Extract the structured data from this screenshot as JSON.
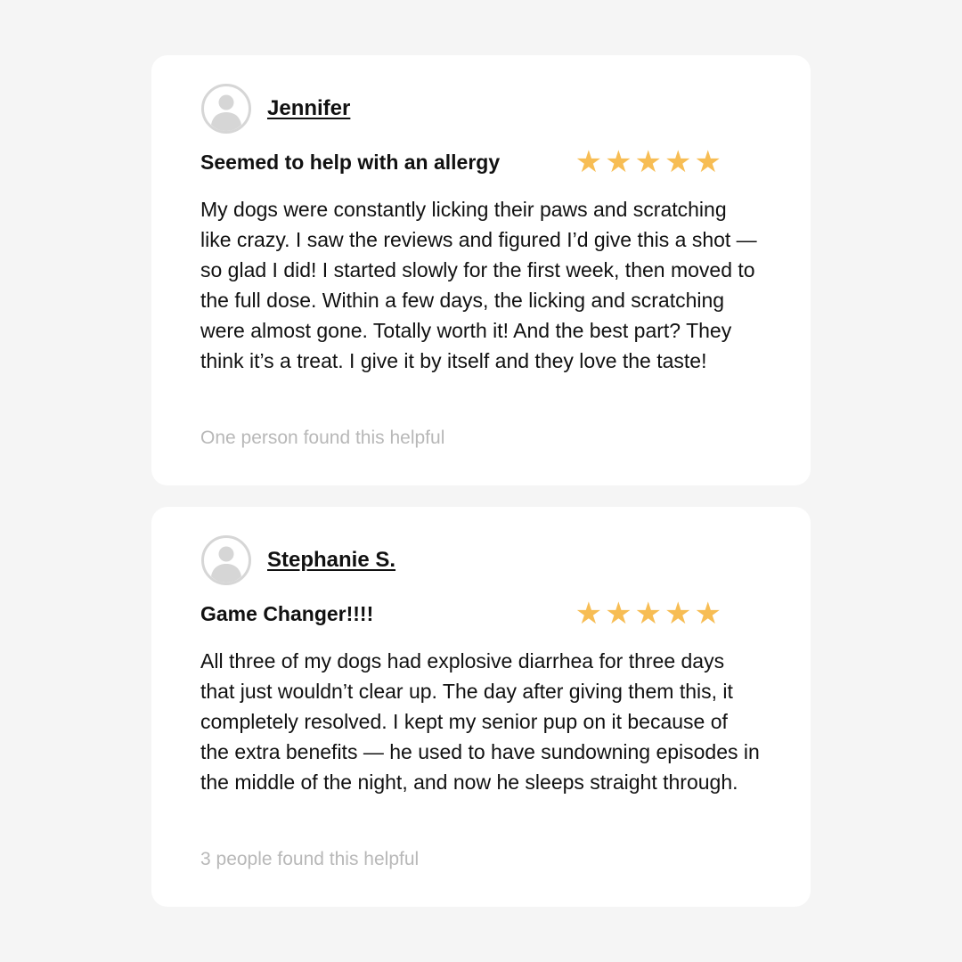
{
  "reviews": [
    {
      "reviewer": "Jennifer",
      "title": "Seemed to help with an allergy",
      "rating": 5,
      "stars": [
        "★",
        "★",
        "★",
        "★",
        "★"
      ],
      "body": "My dogs were constantly licking their paws and scratching like crazy. I saw the reviews and figured I’d give this a shot — so glad I did! I started slowly for the first week, then moved to the full dose. Within a few days, the licking and scratching were almost gone. Totally worth it! And the best part? They think it’s a treat. I give it by itself and they love the taste!",
      "helpful": "One person found this helpful"
    },
    {
      "reviewer": "Stephanie S.",
      "title": "Game Changer!!!!",
      "rating": 5,
      "stars": [
        "★",
        "★",
        "★",
        "★",
        "★"
      ],
      "body": "All three of my dogs had explosive diarrhea for three days that just wouldn’t clear up. The day after giving them this, it completely resolved. I kept my senior pup on it because of the extra benefits — he used to have sundowning episodes in the middle of the night, and now he sleeps straight through.",
      "helpful": "3 people found this helpful"
    }
  ],
  "colors": {
    "star": "#f7bd54",
    "helpful_text": "#b8b8b8",
    "background": "#f5f5f5",
    "card": "#ffffff"
  },
  "icons": {
    "avatar": "user-avatar-icon",
    "star": "star-icon"
  }
}
